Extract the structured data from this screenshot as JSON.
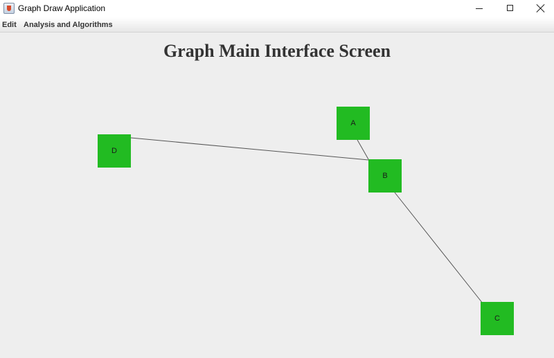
{
  "window": {
    "title": "Graph Draw Application",
    "controls": {
      "minimize": "minimize",
      "maximize": "maximize",
      "close": "close"
    }
  },
  "menubar": {
    "items": [
      {
        "label": "Edit"
      },
      {
        "label": "Analysis and Algorithms"
      }
    ]
  },
  "canvas": {
    "heading": "Graph Main Interface Screen",
    "node_color": "#22bb22",
    "edge_color": "#555555",
    "background_color": "#eeeeee"
  },
  "graph": {
    "nodes": [
      {
        "id": "A",
        "label": "A"
      },
      {
        "id": "B",
        "label": "B"
      },
      {
        "id": "C",
        "label": "C"
      },
      {
        "id": "D",
        "label": "D"
      }
    ],
    "edges": [
      {
        "from": "A",
        "to": "B"
      },
      {
        "from": "D",
        "to": "B"
      },
      {
        "from": "B",
        "to": "C"
      }
    ]
  }
}
